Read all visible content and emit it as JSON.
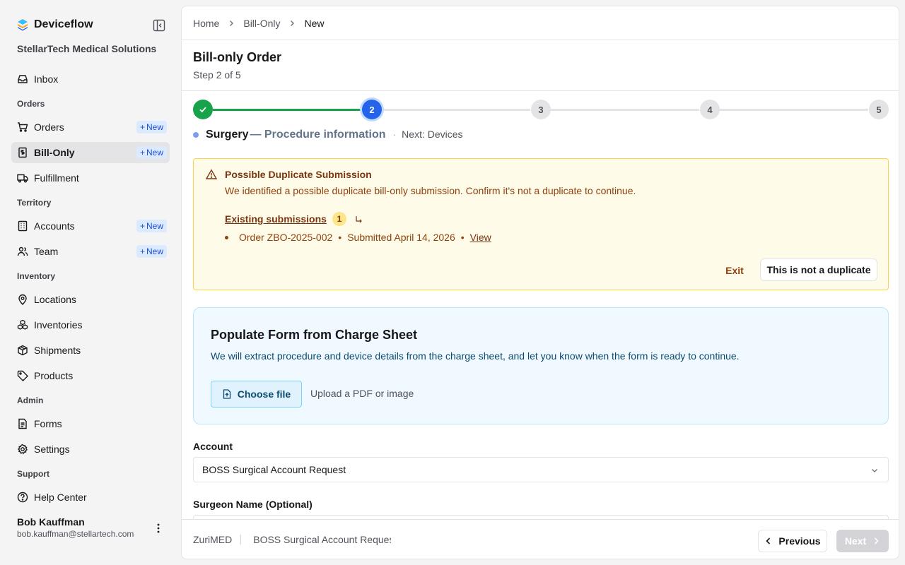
{
  "app": {
    "name": "Deviceflow",
    "org": "StellarTech Medical Solutions"
  },
  "sidebar": {
    "inbox": "Inbox",
    "sections": {
      "orders": "Orders",
      "territory": "Territory",
      "inventory": "Inventory",
      "admin": "Admin",
      "support": "Support"
    },
    "items": {
      "orders": "Orders",
      "bill_only": "Bill-Only",
      "fulfillment": "Fulfillment",
      "accounts": "Accounts",
      "team": "Team",
      "locations": "Locations",
      "inventories": "Inventories",
      "shipments": "Shipments",
      "products": "Products",
      "forms": "Forms",
      "settings": "Settings",
      "help_center": "Help Center"
    },
    "new_badge": "New",
    "user": {
      "name": "Bob Kauffman",
      "email": "bob.kauffman@stellartech.com"
    }
  },
  "breadcrumb": {
    "home": "Home",
    "bill_only": "Bill-Only",
    "current": "New"
  },
  "page": {
    "title": "Bill-only Order",
    "step_text": "Step 2 of 5"
  },
  "stepper": {
    "steps": [
      "1",
      "2",
      "3",
      "4",
      "5"
    ],
    "current": 2,
    "label": "Surgery",
    "description": "— Procedure information",
    "separator": "·",
    "next": "Next: Devices"
  },
  "warning": {
    "title": "Possible Duplicate Submission",
    "message": "We identified a possible duplicate bill-only submission. Confirm it's not a duplicate to continue.",
    "existing_label": "Existing submissions",
    "count": "1",
    "submission": {
      "order": "Order ZBO-2025-002",
      "submitted": "Submitted April 14, 2026",
      "view": "View",
      "sep": "•"
    },
    "exit": "Exit",
    "not_duplicate": "This is not a duplicate"
  },
  "charge_sheet": {
    "title": "Populate Form from Charge Sheet",
    "description": "We will extract procedure and device details from the charge sheet, and let you know when the form is ready to continue.",
    "choose_file": "Choose file",
    "hint": "Upload a PDF or image"
  },
  "form": {
    "account_label": "Account",
    "account_value": "BOSS Surgical Account Request",
    "surgeon_label": "Surgeon Name (Optional)"
  },
  "footer": {
    "manufacturer": "ZuriMED",
    "account": "BOSS Surgical Account Request",
    "previous": "Previous",
    "next": "Next"
  },
  "colors": {
    "accent": "#2563eb",
    "success": "#16a34a",
    "warning_bg": "#fefce8",
    "info_bg": "#f0f9ff"
  }
}
